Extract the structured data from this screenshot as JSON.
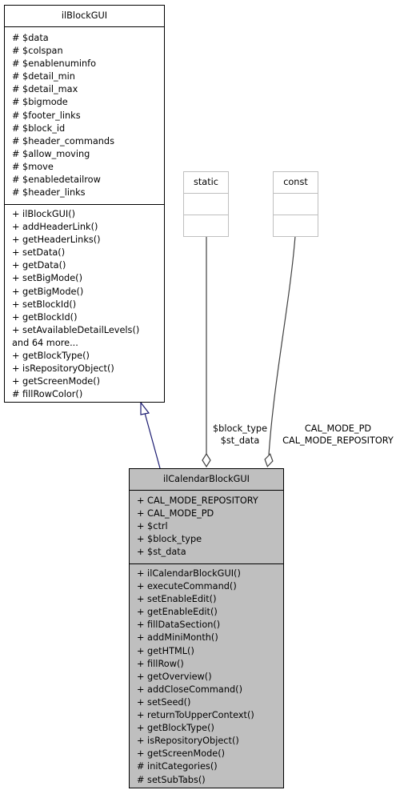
{
  "diagram": {
    "type": "UML class collaboration diagram",
    "base_class": {
      "name": "ilBlockGUI",
      "attributes": [
        "# $data",
        "# $colspan",
        "# $enablenuminfo",
        "# $detail_min",
        "# $detail_max",
        "# $bigmode",
        "# $footer_links",
        "# $block_id",
        "# $header_commands",
        "# $allow_moving",
        "# $move",
        "# $enabledetailrow",
        "# $header_links"
      ],
      "methods": [
        "+ ilBlockGUI()",
        "+ addHeaderLink()",
        "+ getHeaderLinks()",
        "+ setData()",
        "+ getData()",
        "+ setBigMode()",
        "+ getBigMode()",
        "+ setBlockId()",
        "+ getBlockId()",
        "+ setAvailableDetailLevels()",
        "and 64 more...",
        "+ getBlockType()",
        "+ isRepositoryObject()",
        "+ getScreenMode()",
        "# fillRowColor()"
      ]
    },
    "derived_class": {
      "name": "ilCalendarBlockGUI",
      "attributes": [
        "+ CAL_MODE_REPOSITORY",
        "+ CAL_MODE_PD",
        "+ $ctrl",
        "+ $block_type",
        "+ $st_data"
      ],
      "methods": [
        "+ ilCalendarBlockGUI()",
        "+ executeCommand()",
        "+ setEnableEdit()",
        "+ getEnableEdit()",
        "+ fillDataSection()",
        "+ addMiniMonth()",
        "+ getHTML()",
        "+ fillRow()",
        "+ getOverview()",
        "+ addCloseCommand()",
        "+ setSeed()",
        "+ returnToUpperContext()",
        "+ getBlockType()",
        "+ isRepositoryObject()",
        "+ getScreenMode()",
        "# initCategories()",
        "# setSubTabs()"
      ]
    },
    "ghost_nodes": [
      {
        "name": "static"
      },
      {
        "name": "const"
      }
    ],
    "edges": [
      {
        "from": "ilCalendarBlockGUI",
        "to": "ilBlockGUI",
        "kind": "inheritance",
        "color": "#191970"
      },
      {
        "from": "static",
        "to": "ilCalendarBlockGUI",
        "kind": "aggregation",
        "labels": [
          "$block_type",
          "$st_data"
        ],
        "color": "#404040"
      },
      {
        "from": "const",
        "to": "ilCalendarBlockGUI",
        "kind": "aggregation",
        "labels": [
          "CAL_MODE_PD",
          "CAL_MODE_REPOSITORY"
        ],
        "color": "#404040"
      }
    ],
    "colors": {
      "derived_fill": "#bfbfbf",
      "ghost_border": "#bfbfbf",
      "inheritance_edge": "#191970"
    }
  }
}
